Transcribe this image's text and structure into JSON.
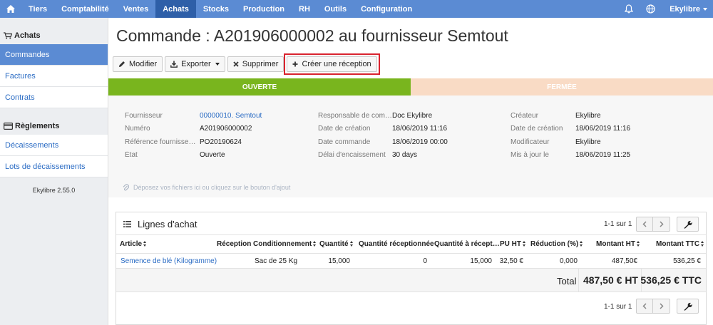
{
  "navbar": {
    "items": [
      "Tiers",
      "Comptabilité",
      "Ventes",
      "Achats",
      "Stocks",
      "Production",
      "RH",
      "Outils",
      "Configuration"
    ],
    "active": "Achats",
    "user": "Ekylibre",
    "icons": [
      "home-icon",
      "bell-icon",
      "globe-icon"
    ]
  },
  "sidebar": {
    "section1": "Achats",
    "items1": [
      "Commandes",
      "Factures",
      "Contrats"
    ],
    "section2": "Règlements",
    "items2": [
      "Décaissements",
      "Lots de décaissements"
    ],
    "version": "Ekylibre 2.55.0"
  },
  "page": {
    "title": "Commande : A201906000002 au fournisseur Semtout"
  },
  "toolbar": {
    "edit": "Modifier",
    "export": "Exporter",
    "delete": "Supprimer",
    "create_reception": "Créer une réception"
  },
  "status": {
    "open": "OUVERTE",
    "closed": "FERMÉE",
    "open_color": "#79b51e",
    "closed_color": "#f9dbc5"
  },
  "info": {
    "col1": [
      {
        "label": "Fournisseur",
        "value": "00000010. Semtout"
      },
      {
        "label": "Numéro",
        "value": "A201906000002"
      },
      {
        "label": "Référence fournisseu…",
        "value": "PO20190624"
      },
      {
        "label": "État",
        "value": "Ouverte"
      }
    ],
    "col2": [
      {
        "label": "Responsable de com…",
        "value": "Doc Ekylibre"
      },
      {
        "label": "Date de création",
        "value": "18/06/2019 11:16"
      },
      {
        "label": "Date commande",
        "value": "18/06/2019 00:00"
      },
      {
        "label": "Délai d'encaissement",
        "value": "30 days"
      }
    ],
    "col3": [
      {
        "label": "Créateur",
        "value": "Ekylibre"
      },
      {
        "label": "Date de création",
        "value": "18/06/2019 11:16"
      },
      {
        "label": "Modificateur",
        "value": "Ekylibre"
      },
      {
        "label": "Mis à jour le",
        "value": "18/06/2019 11:25"
      }
    ]
  },
  "dropzone": "Déposez vos fichiers ici ou cliquez sur le bouton d'ajout",
  "lines": {
    "title": "Lignes d'achat",
    "pager_top": "1-1 sur 1",
    "pager_bottom": "1-1 sur 1",
    "headers": {
      "article": "Article",
      "reception": "Réception",
      "conditioning": "Conditionnement",
      "quantity": "Quantité",
      "qty_received": "Quantité réceptionnée",
      "qty_to_receive": "Quantité à récept…",
      "unit_price": "PU HT",
      "reduction": "Réduction (%)",
      "amount_ht": "Montant HT",
      "amount_ttc": "Montant TTC"
    },
    "rows": [
      {
        "article": "Semence de blé (Kilogramme)",
        "reception": "",
        "conditioning": "Sac de 25 Kg",
        "quantity": "15,000",
        "qty_received": "0",
        "qty_to_receive": "15,000",
        "unit_price": "32,50 €",
        "reduction": "0,000",
        "amount_ht": "487,50€",
        "amount_ttc": "536,25 €"
      }
    ],
    "total_label": "Total",
    "total_ht": "487,50 € HT",
    "total_ttc": "536,25 € TTC"
  }
}
